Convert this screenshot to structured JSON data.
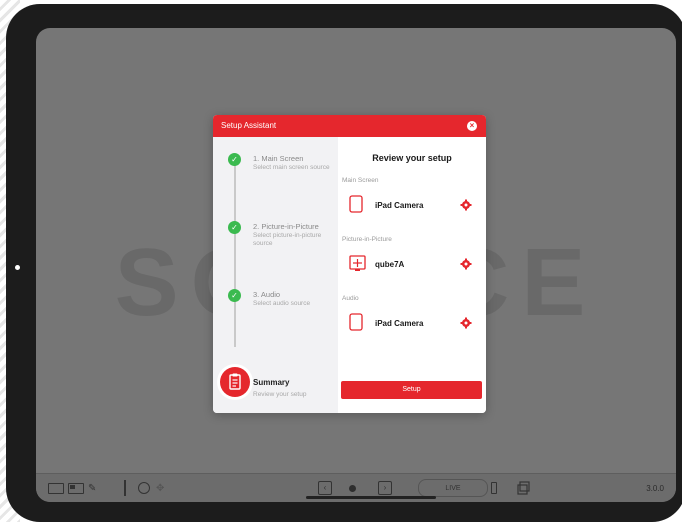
{
  "screen": {
    "watermark": "SOURCE"
  },
  "dialog": {
    "title": "Setup Assistant",
    "close_glyph": "×",
    "steps": [
      {
        "number_label": "1. Main Screen",
        "description": "Select main screen source",
        "status": "done"
      },
      {
        "number_label": "2. Picture-in-Picture",
        "description": "Select picture-in-picture source",
        "status": "done"
      },
      {
        "number_label": "3. Audio",
        "description": "Select audio source",
        "status": "done"
      }
    ],
    "summary": {
      "title": "Summary",
      "description": "Review your setup"
    },
    "review": {
      "title": "Review your setup",
      "sections": [
        {
          "label": "Main Screen",
          "source": "iPad Camera",
          "icon": "ipad-icon"
        },
        {
          "label": "Picture-in-Picture",
          "source": "qube7A",
          "icon": "camera-device-icon"
        },
        {
          "label": "Audio",
          "source": "iPad Camera",
          "icon": "ipad-icon"
        }
      ],
      "setup_button": "Setup"
    }
  },
  "toolbar": {
    "live_label": "LIVE",
    "version": "3.0.0"
  },
  "colors": {
    "accent": "#e5272d",
    "step_done": "#3bba4f",
    "screen_bg": "#767676"
  }
}
